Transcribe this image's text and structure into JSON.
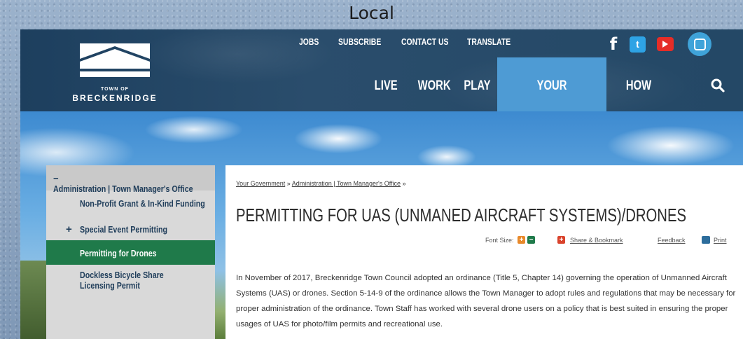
{
  "caption": "Local",
  "logo": {
    "town_of": "TOWN OF",
    "name": "BRECKENRIDGE"
  },
  "utility_nav": [
    "JOBS",
    "SUBSCRIBE",
    "CONTACT US",
    "TRANSLATE"
  ],
  "social": {
    "facebook": "f",
    "twitter": "t"
  },
  "main_nav": [
    "LIVE",
    "WORK",
    "PLAY",
    "YOUR GOVERNMENT",
    "HOW DO I..."
  ],
  "main_nav_active": "YOUR GOVERNMENT",
  "sidebar": {
    "heading_toggle": "−",
    "heading": "Administration | Town Manager's Office",
    "items": [
      {
        "label": "Non-Profit Grant & In-Kind Funding"
      },
      {
        "toggle": "+",
        "label": "Special Event Permitting"
      },
      {
        "label": "Permitting for Drones",
        "active": true
      },
      {
        "label": "Dockless Bicycle Share Licensing Permit"
      }
    ]
  },
  "breadcrumb": {
    "items": [
      "Your Government",
      "Administration | Town Manager's Office"
    ],
    "separator": "»"
  },
  "page_title": "PERMITTING FOR UAS (UNMANED AIRCRAFT SYSTEMS)/DRONES",
  "tools": {
    "font_size_label": "Font Size:",
    "font_plus": "+",
    "font_minus": "−",
    "share_icon": "+",
    "share_label": "Share & Bookmark",
    "feedback_label": "Feedback",
    "print_label": "Print"
  },
  "body_text": "In November of 2017, Breckenridge Town Council adopted an ordinance (Title 5, Chapter 14) governing the operation of Unmanned Aircraft Systems (UAS) or drones. Section 5-14-9 of the ordinance allows the Town Manager to adopt rules and regulations that may be necessary for proper administration of the ordinance. Town Staff has worked with several drone users on a policy that is best suited in ensuring the proper usages of UAS for photo/film permits and recreational use.",
  "colors": {
    "header": "#244866",
    "nav_active": "#4e9bd4",
    "sidebar_active": "#1f7a4a",
    "sidebar_bg": "#d9d9d9"
  }
}
